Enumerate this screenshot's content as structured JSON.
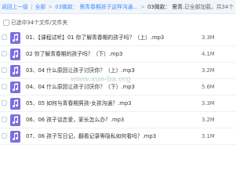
{
  "breadcrumb": {
    "back": "返回上一级",
    "sep": "|",
    "all_files": "全部",
    "gt": ">",
    "folder1": "03微款：",
    "folder2": "需青春期孩子这样沟通...",
    "current_prefix": "03微款：",
    "current": "需青...",
    "loaded": "已全部加载，共34个"
  },
  "list_header": {
    "label": "已选中34个文件/文件夹"
  },
  "files": [
    {
      "name": "01、【课程试听】01 你了解青春期的孩子吗？（上）.mp3",
      "size": "3.3M"
    },
    {
      "name": "02 你了解青春期的孩子吗？（下）.mp3",
      "size": "4.1M"
    },
    {
      "name": "03、04 什么原因让孩子讨厌你？（上）.mp3",
      "size": "3.2M"
    },
    {
      "name": "04、04 什么原因让孩子讨厌你？（下）.mp3",
      "size": "5.6M"
    },
    {
      "name": "05、05 如何与青春期男孩-女孩沟通？.mp3",
      "size": "3.3M"
    },
    {
      "name": "06、06 孩子谈恋爱，家长怎么办？.mp3",
      "size": "3.2M"
    },
    {
      "name": "07、06 孩子写日记，翻看记录等隐私如何看吗？.mp3",
      "size": "3.1M"
    }
  ],
  "watermark": "www.xue-ba.org",
  "colors": {
    "link": "#3b8cff",
    "icon_bg": "#7b6fe0",
    "header_bg": "#f2f6fb"
  }
}
